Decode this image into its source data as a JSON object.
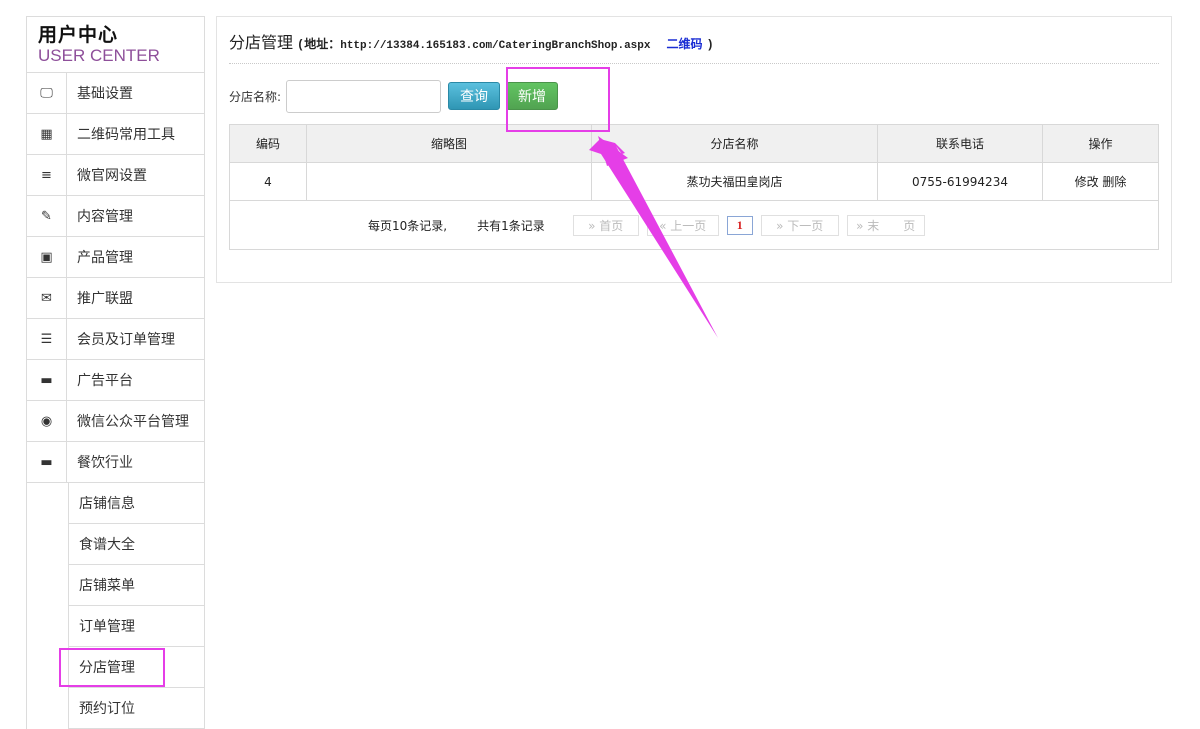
{
  "brand": {
    "title": "用户中心",
    "subtitle": "USER CENTER"
  },
  "sidebar": {
    "items": [
      {
        "label": "基础设置",
        "icon": "monitor-icon",
        "glyph": "🖵"
      },
      {
        "label": "二维码常用工具",
        "icon": "qrcode-icon",
        "glyph": "▦"
      },
      {
        "label": "微官网设置",
        "icon": "list-icon",
        "glyph": "≡"
      },
      {
        "label": "内容管理",
        "icon": "edit-icon",
        "glyph": "✎"
      },
      {
        "label": "产品管理",
        "icon": "image-icon",
        "glyph": "▣"
      },
      {
        "label": "推广联盟",
        "icon": "gift-icon",
        "glyph": "✉"
      },
      {
        "label": "会员及订单管理",
        "icon": "database-icon",
        "glyph": "☰"
      },
      {
        "label": "广告平台",
        "icon": "cup-icon",
        "glyph": "▬"
      },
      {
        "label": "微信公众平台管理",
        "icon": "chat-icon",
        "glyph": "◉"
      },
      {
        "label": "餐饮行业",
        "icon": "coffee-icon",
        "glyph": "▬"
      }
    ],
    "sub_items": [
      {
        "label": "店铺信息"
      },
      {
        "label": "食谱大全"
      },
      {
        "label": "店铺菜单"
      },
      {
        "label": "订单管理"
      },
      {
        "label": "分店管理"
      },
      {
        "label": "预约订位"
      }
    ]
  },
  "main": {
    "title": "分店管理",
    "address_prefix": "(地址：",
    "address_url": "http://13384.165183.com/CateringBranchShop.aspx",
    "qr_label": "二维码",
    "address_suffix": ")",
    "search_label": "分店名称:",
    "search_value": "",
    "query_button": "查询",
    "add_button": "新增",
    "table": {
      "headers": [
        "编码",
        "缩略图",
        "分店名称",
        "联系电话",
        "操作"
      ],
      "rows": [
        {
          "code": "4",
          "thumb": "",
          "name": "蒸功夫福田皇岗店",
          "phone": "0755-61994234",
          "edit": "修改",
          "delete": "删除"
        }
      ]
    },
    "pager": {
      "per_page": "每页10条记录,",
      "total": "共有1条记录",
      "first": "» 首页",
      "prev": "« 上一页",
      "current": "1",
      "next": "» 下一页",
      "last": "» 末　　页"
    }
  },
  "colors": {
    "highlight": "#e53ee7",
    "query": "#2f96b4",
    "add": "#51a351",
    "brand_sub": "#8e4f9a"
  }
}
